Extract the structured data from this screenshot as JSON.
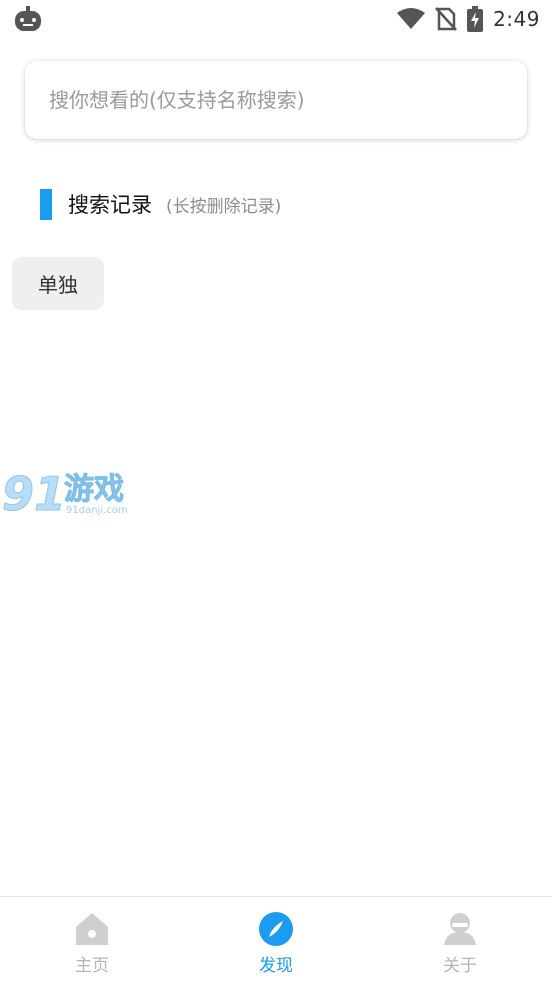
{
  "status_bar": {
    "time": "2:49",
    "icons": [
      "app-notification-icon",
      "wifi-icon",
      "no-sim-icon",
      "battery-charging-icon"
    ]
  },
  "search": {
    "placeholder": "搜你想看的(仅支持名称搜索)",
    "value": ""
  },
  "history": {
    "title": "搜索记录",
    "hint": "(长按删除记录)",
    "items": [
      "单独"
    ]
  },
  "watermark": {
    "text": "91游戏",
    "sub": "91danji.com"
  },
  "bottom_nav": {
    "items": [
      {
        "label": "主页",
        "icon": "home-icon",
        "active": false
      },
      {
        "label": "发现",
        "icon": "compass-icon",
        "active": true
      },
      {
        "label": "关于",
        "icon": "user-icon",
        "active": false
      }
    ]
  },
  "colors": {
    "accent": "#1a9cf0",
    "inactive": "#b4b4b4",
    "chip_bg": "#efefef"
  }
}
